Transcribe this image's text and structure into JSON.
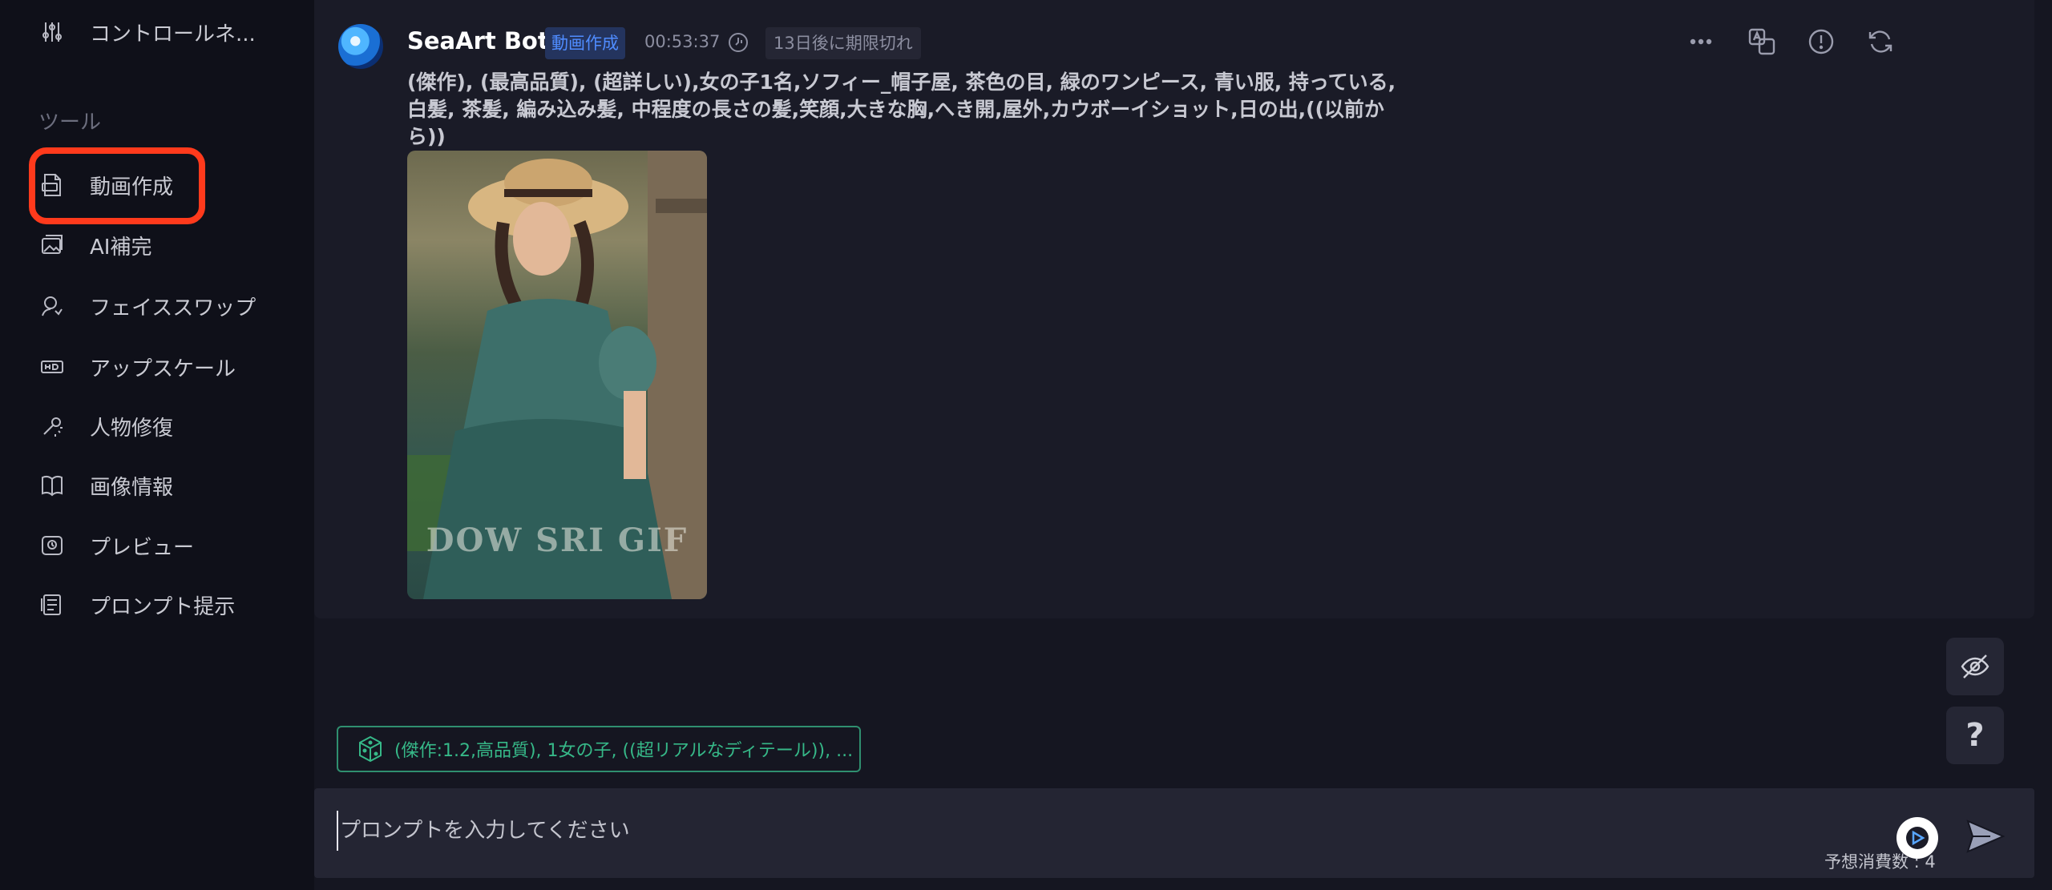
{
  "sidebar": {
    "top_item": {
      "label": "コントロールネ...",
      "icon": "sliders-icon"
    },
    "section_label": "ツール",
    "items": [
      {
        "label": "動画作成",
        "icon": "gif-file-icon"
      },
      {
        "label": "AI補完",
        "icon": "image-stack-icon"
      },
      {
        "label": "フェイススワップ",
        "icon": "face-swap-icon"
      },
      {
        "label": "アップスケール",
        "icon": "hd-icon"
      },
      {
        "label": "人物修復",
        "icon": "magic-wrench-icon"
      },
      {
        "label": "画像情報",
        "icon": "book-icon"
      },
      {
        "label": "プレビュー",
        "icon": "preview-icon"
      },
      {
        "label": "プロンプト提示",
        "icon": "prompt-list-icon"
      }
    ],
    "highlight_color": "#ff3a1c"
  },
  "message": {
    "bot_name": "SeaArt Bot",
    "mode_badge": "動画作成",
    "time": "00:53:37",
    "expiry": "13日後に期限切れ",
    "prompt": "(傑作), (最高品質), (超詳しい),女の子1名,ソフィー_帽子屋, 茶色の目, 緑のワンピース, 青い服, 持っている, 白髪, 茶髪, 編み込み髪, 中程度の長さの髪,笑顔,大きな胸,へき開,屋外,カウボーイショット,日の出,((以前から))",
    "image_watermark": "DOW SRI GIF",
    "actions": [
      "more-icon",
      "translate-icon",
      "report-icon",
      "refresh-icon"
    ]
  },
  "suggestion": {
    "text": "(傑作:1.2,高品質), 1女の子, ((超リアルなディテール)), ..."
  },
  "input": {
    "placeholder": "プロンプトを入力してください",
    "value": "",
    "cost": "予想消費数 : 4"
  },
  "colors": {
    "background": "#151621",
    "sidebar": "#0f1019",
    "accent_blue": "#4f8cff",
    "accent_green": "#36b888"
  }
}
